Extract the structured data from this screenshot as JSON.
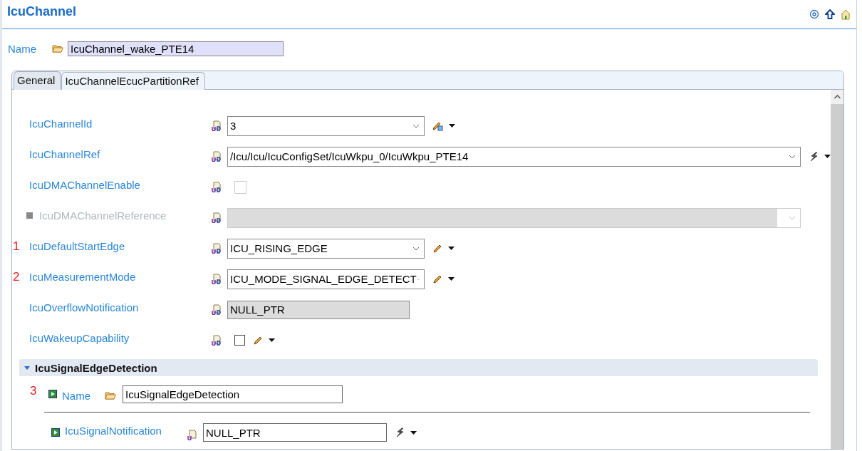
{
  "title": "IcuChannel",
  "name_field": {
    "label": "Name",
    "value": "IcuChannel_wake_PTE14"
  },
  "tabs": [
    {
      "label": "General",
      "selected": true
    },
    {
      "label": "IcuChannelEcucPartitionRef",
      "selected": false
    }
  ],
  "rows": [
    {
      "label": "IcuChannelId",
      "kind": "combo",
      "value": "3",
      "wide": false,
      "disabled": false,
      "action": {
        "kind": "calc"
      }
    },
    {
      "label": "IcuChannelRef",
      "kind": "combo",
      "value": "/Icu/Icu/IcuConfigSet/IcuWkpu_0/IcuWkpu_PTE14",
      "wide": true,
      "disabled": false,
      "action": {
        "kind": "reference"
      }
    },
    {
      "label": "IcuDMAChannelEnable",
      "kind": "checkbox",
      "checked": false,
      "disabled": true
    },
    {
      "label": "IcuDMAChannelReference",
      "kind": "combo",
      "wide": true,
      "disabled": true
    },
    {
      "label": "IcuDefaultStartEdge",
      "marker": "1",
      "kind": "combo",
      "value": "ICU_RISING_EDGE",
      "wide": false,
      "disabled": false,
      "action": {
        "kind": "edit"
      }
    },
    {
      "label": "IcuMeasurementMode",
      "marker": "2",
      "kind": "combo",
      "value": "ICU_MODE_SIGNAL_EDGE_DETECT",
      "wide": false,
      "disabled": false,
      "action": {
        "kind": "edit"
      }
    },
    {
      "label": "IcuOverflowNotification",
      "kind": "text",
      "value": "NULL_PTR",
      "disabled": true
    },
    {
      "label": "IcuWakeupCapability",
      "kind": "checkbox",
      "checked": false,
      "disabled": false,
      "action": {
        "kind": "edit"
      }
    }
  ],
  "section": {
    "title": "IcuSignalEdgeDetection",
    "expanded": true,
    "name_field": {
      "marker": "3",
      "label": "Name",
      "value": "IcuSignalEdgeDetection"
    },
    "rows": [
      {
        "label": "IcuSignalNotification",
        "value": "NULL_PTR",
        "action": {
          "kind": "reference"
        }
      }
    ]
  }
}
